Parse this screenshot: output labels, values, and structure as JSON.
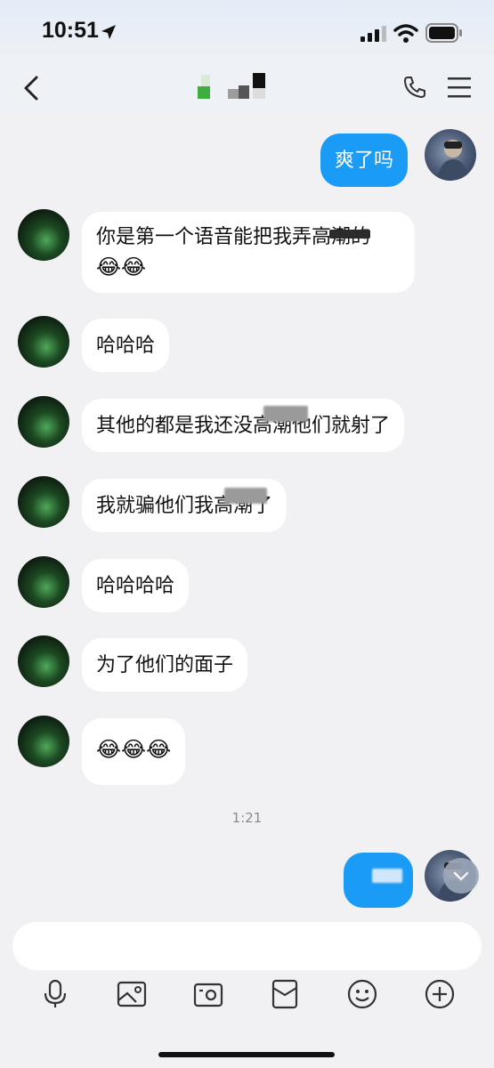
{
  "status_bar": {
    "time": "10:51"
  },
  "nav": {
    "title": ""
  },
  "messages": [
    {
      "from": "me",
      "text": "爽了吗"
    },
    {
      "from": "them",
      "line1": "你是第一个语音能把我弄高潮的",
      "emoji_line": "😂😂"
    },
    {
      "from": "them",
      "text": "哈哈哈"
    },
    {
      "from": "them",
      "text": "其他的都是我还没高潮他们就射了"
    },
    {
      "from": "them",
      "text": "我就骗他们我高潮了"
    },
    {
      "from": "them",
      "text": "哈哈哈哈"
    },
    {
      "from": "them",
      "text": "为了他们的面子"
    },
    {
      "from": "them",
      "text": "😂😂😂"
    },
    {
      "from": "me",
      "text": ""
    }
  ],
  "timestamp": "1:21",
  "input": {
    "placeholder": ""
  },
  "icons": {
    "back": "chevron-left-icon",
    "call": "phone-icon",
    "more": "menu-icon",
    "voice": "microphone-icon",
    "image": "image-icon",
    "camera": "camera-icon",
    "red_packet": "red-packet-icon",
    "emoji": "emoji-icon",
    "plus": "plus-icon"
  },
  "colors": {
    "accent": "#1a9bf5",
    "background": "#f1f1f3",
    "bubble_in": "#ffffff"
  }
}
